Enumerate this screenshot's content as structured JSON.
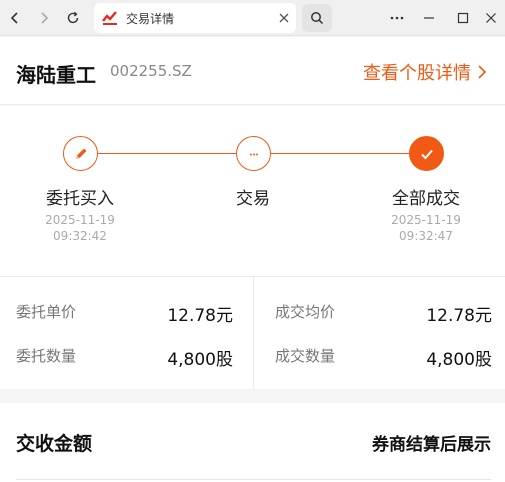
{
  "browser": {
    "tab_title": "交易详情"
  },
  "header": {
    "stock_name": "海陆重工",
    "stock_code": "002255.SZ",
    "detail_link": "查看个股详情"
  },
  "steps": [
    {
      "label": "委托买入",
      "date": "2025-11-19",
      "time": "09:32:42",
      "icon": "pencil-icon"
    },
    {
      "label": "交易",
      "date": "",
      "time": "",
      "icon": "ellipsis-icon"
    },
    {
      "label": "全部成交",
      "date": "2025-11-19",
      "time": "09:32:47",
      "icon": "check-icon"
    }
  ],
  "order": {
    "price_label": "委托单价",
    "price_value": "12.78元",
    "qty_label": "委托数量",
    "qty_value": "4,800股"
  },
  "deal": {
    "price_label": "成交均价",
    "price_value": "12.78元",
    "qty_label": "成交数量",
    "qty_value": "4,800股"
  },
  "settlement": {
    "title": "交收金额",
    "note": "券商结算后展示"
  },
  "colors": {
    "accent": "#f05a14"
  }
}
